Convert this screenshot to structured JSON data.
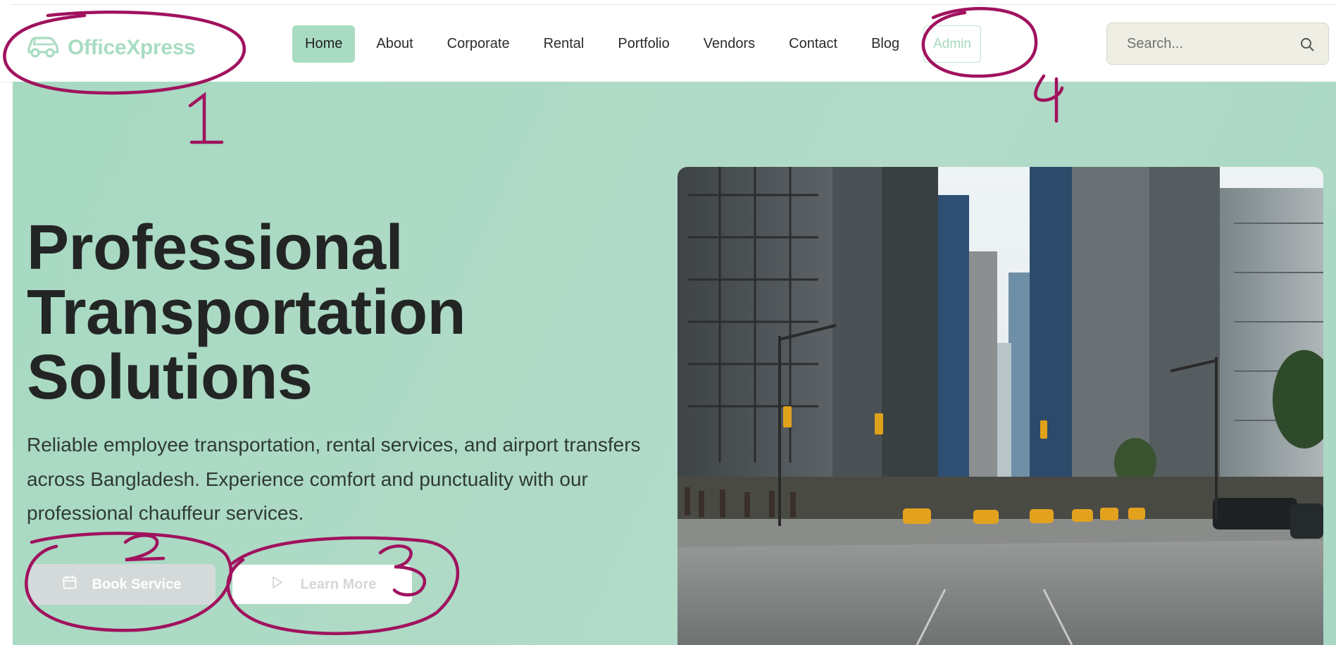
{
  "brand": {
    "name": "OfficeXpress",
    "icon": "car-icon",
    "color": "#a8dcc2"
  },
  "nav": {
    "items": [
      {
        "label": "Home",
        "active": true
      },
      {
        "label": "About",
        "active": false
      },
      {
        "label": "Corporate",
        "active": false
      },
      {
        "label": "Rental",
        "active": false
      },
      {
        "label": "Portfolio",
        "active": false
      },
      {
        "label": "Vendors",
        "active": false
      },
      {
        "label": "Contact",
        "active": false
      },
      {
        "label": "Blog",
        "active": false
      }
    ],
    "admin_label": "Admin",
    "accent": "#a9dbc3"
  },
  "search": {
    "placeholder": "Search...",
    "value": "",
    "icon": "search-icon"
  },
  "hero": {
    "title": "Professional\nTransportation\nSolutions",
    "description": "Reliable employee transportation, rental services, and airport transfers across Bangladesh. Experience comfort and punctuality with our professional chauffeur services.",
    "book_label": "Book Service",
    "book_icon": "calendar-icon",
    "learn_label": "Learn More",
    "learn_icon": "play-icon",
    "image": "city-street-photo",
    "background": "#b0dbc6"
  },
  "annotations": {
    "color": "#a0125e",
    "labels": [
      "1",
      "2",
      "3",
      "4"
    ]
  }
}
